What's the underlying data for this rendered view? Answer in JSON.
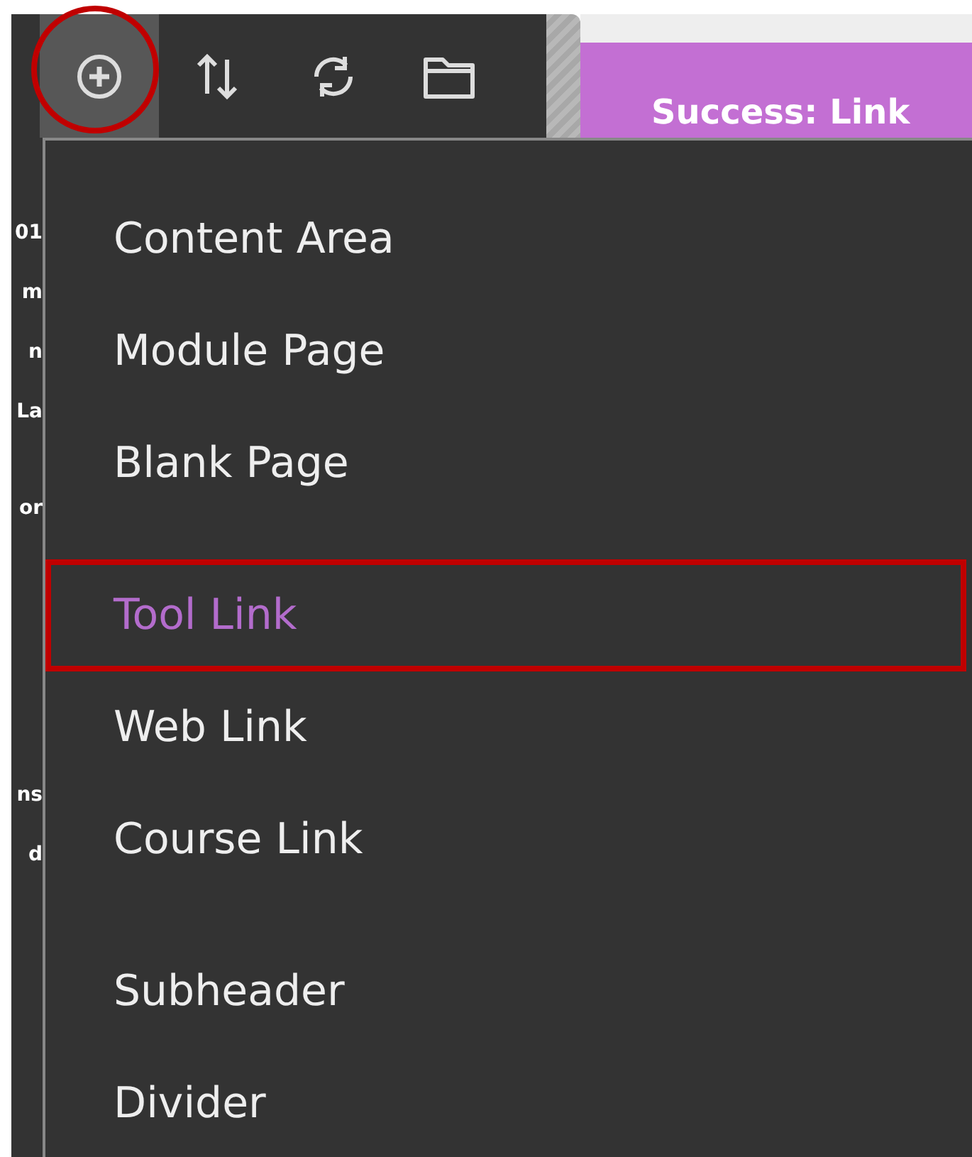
{
  "toolbar": [
    {
      "kind": "add",
      "selected": true,
      "highlighted": true
    },
    {
      "kind": "sort",
      "selected": false,
      "highlighted": false
    },
    {
      "kind": "refresh",
      "selected": false,
      "highlighted": false
    },
    {
      "kind": "folder",
      "selected": false,
      "highlighted": false
    }
  ],
  "banner": {
    "text": "Success: Link"
  },
  "sidebar_fragments": [
    "01",
    "m",
    "n",
    "La",
    "or",
    "ns",
    "d"
  ],
  "menu": {
    "groups": [
      [
        {
          "label": "Content Area",
          "selected": false,
          "highlighted": false
        },
        {
          "label": "Module Page",
          "selected": false,
          "highlighted": false
        },
        {
          "label": "Blank Page",
          "selected": false,
          "highlighted": false
        }
      ],
      [
        {
          "label": "Tool Link",
          "selected": true,
          "highlighted": true
        },
        {
          "label": "Web Link",
          "selected": false,
          "highlighted": false
        },
        {
          "label": "Course Link",
          "selected": false,
          "highlighted": false
        }
      ],
      [
        {
          "label": "Subheader",
          "selected": false,
          "highlighted": false
        },
        {
          "label": "Divider",
          "selected": false,
          "highlighted": false
        }
      ]
    ]
  }
}
